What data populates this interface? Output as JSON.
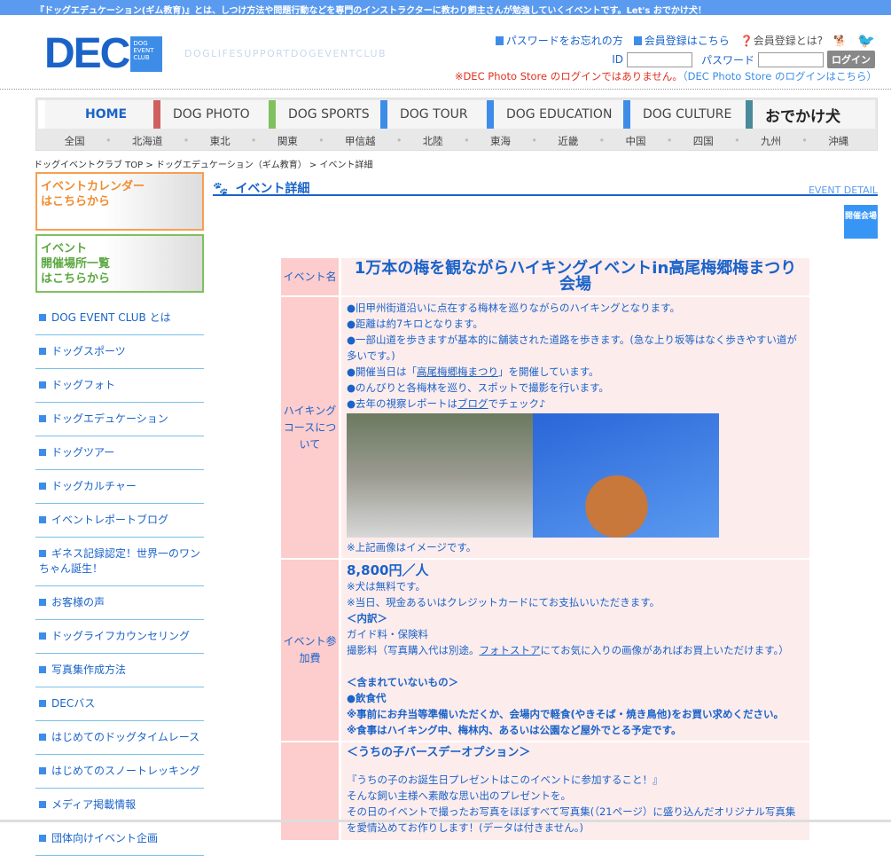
{
  "topbar": "『ドッグエデュケーション(ギム教育)』とは、しつけ方法や問題行動などを専門のインストラクターに教わり飼主さんが勉強していくイベントです。Let's おでかけ犬！",
  "logo": {
    "main": "DEC",
    "box": [
      "DOG",
      "EVENT",
      "CLUB"
    ],
    "tagline": "DOGLIFESUPPORTDOGEVENTCLUB"
  },
  "header": {
    "forgot": "パスワードをお忘れの方",
    "register": "会員登録はこちら",
    "about": "会員登録とは?",
    "id_label": "ID",
    "pw_label": "パスワード",
    "login": "ログイン",
    "notice": "※DEC Photo Store のログインではありません。",
    "notice_link": "（DEC Photo Store のログインはこちら）",
    "id_value": "",
    "pw_value": ""
  },
  "nav": {
    "main": [
      {
        "label": "HOME",
        "color": "#ffffff"
      },
      {
        "label": "DOG PHOTO",
        "color": "#d06060"
      },
      {
        "label": "DOG SPORTS",
        "color": "#80c060"
      },
      {
        "label": "DOG TOUR",
        "color": "#3d8de8"
      },
      {
        "label": "DOG EDUCATION",
        "color": "#3d8de8"
      },
      {
        "label": "DOG CULTURE",
        "color": "#3d8de8"
      },
      {
        "label": "おでかけ犬",
        "color": "#4a8a9a"
      }
    ],
    "regions": [
      "全国",
      "北海道",
      "東北",
      "関東",
      "甲信越",
      "北陸",
      "東海",
      "近畿",
      "中国",
      "四国",
      "九州",
      "沖縄"
    ]
  },
  "breadcrumb": "ドッグイベントクラブ TOP > ドッグエデュケーション（ギム教育） > イベント詳細",
  "sidebar": {
    "banners": [
      {
        "line1": "イベントカレンダー",
        "line2": "はこちらから"
      },
      {
        "line1": "イベント",
        "line2": "開催場所一覧",
        "line3": "はこちらから"
      }
    ],
    "items": [
      "DOG EVENT CLUB とは",
      "ドッグスポーツ",
      "ドッグフォト",
      "ドッグエデュケーション",
      "ドッグツアー",
      "ドッグカルチャー",
      "イベントレポートブログ",
      "ギネス記録認定！世界一のワンちゃん誕生！",
      "お客様の声",
      "ドッグライフカウンセリング",
      "写真集作成方法",
      "DECバス",
      "はじめてのドッグタイムレース",
      "はじめてのスノートレッキング",
      "メディア掲載情報",
      "団体向けイベント企画"
    ]
  },
  "page": {
    "title": "イベント詳細",
    "title_en": "EVENT DETAIL",
    "venue_btn": "開催会場"
  },
  "event": {
    "name_label": "イベント名",
    "name": "1万本の梅を観ながらハイキングイベントin高尾梅郷梅まつり会場",
    "course_label": "ハイキングコースについて",
    "course": [
      "●旧甲州街道沿いに点在する梅林を巡りながらのハイキングとなります。",
      "●距離は約7キロとなります。",
      "●一部山道を歩きますが基本的に舗装された道路を歩きます。(急な上り坂等はなく歩きやすい道が多いです。)"
    ],
    "course_festival_pre": "●開催当日は「",
    "course_festival_link": "高尾梅郷梅まつり",
    "course_festival_post": "」を開催しています。",
    "course_photo": "●のんびりと各梅林を巡り、スポットで撮影を行います。",
    "course_blog_pre": "●去年の視察レポートは",
    "course_blog_link": "ブログ",
    "course_blog_post": "でチェック♪",
    "image_note": "※上記画像はイメージです。",
    "fee_label": "イベント参加費",
    "price": "8,800円／人",
    "fee_notes": [
      "※犬は無料です。",
      "※当日、現金あるいはクレジットカードにてお支払いいただきます。"
    ],
    "breakdown": "＜内訳＞",
    "breakdown_item": "ガイド料・保険料",
    "photo_fee_pre": "撮影料（写真購入代は別途。",
    "photo_fee_link": "フォトストア",
    "photo_fee_post": "にてお気に入りの画像があればお買上いただけます。）",
    "excluded": "＜含まれていないもの＞",
    "excluded_items": [
      "●飲食代",
      "※事前にお弁当等準備いただくか、会場内で軽食(やきそば・焼き鳥他)をお買い求めください。",
      "※食事はハイキング中、梅林内、あるいは公園など屋外でとる予定です。"
    ],
    "option_title": "＜うちの子バースデーオプション＞",
    "option_lines": [
      "『うちの子のお誕生日プレゼントはこのイベントに参加すること！』",
      "そんな飼い主様へ素敵な思い出のプレゼントを。",
      "その日のイベントで撮ったお写真をほぼすべて写真集(（21ページ）に盛り込んだオリジナル写真集を愛情込めてお作りします！(データは付きません。)"
    ]
  }
}
